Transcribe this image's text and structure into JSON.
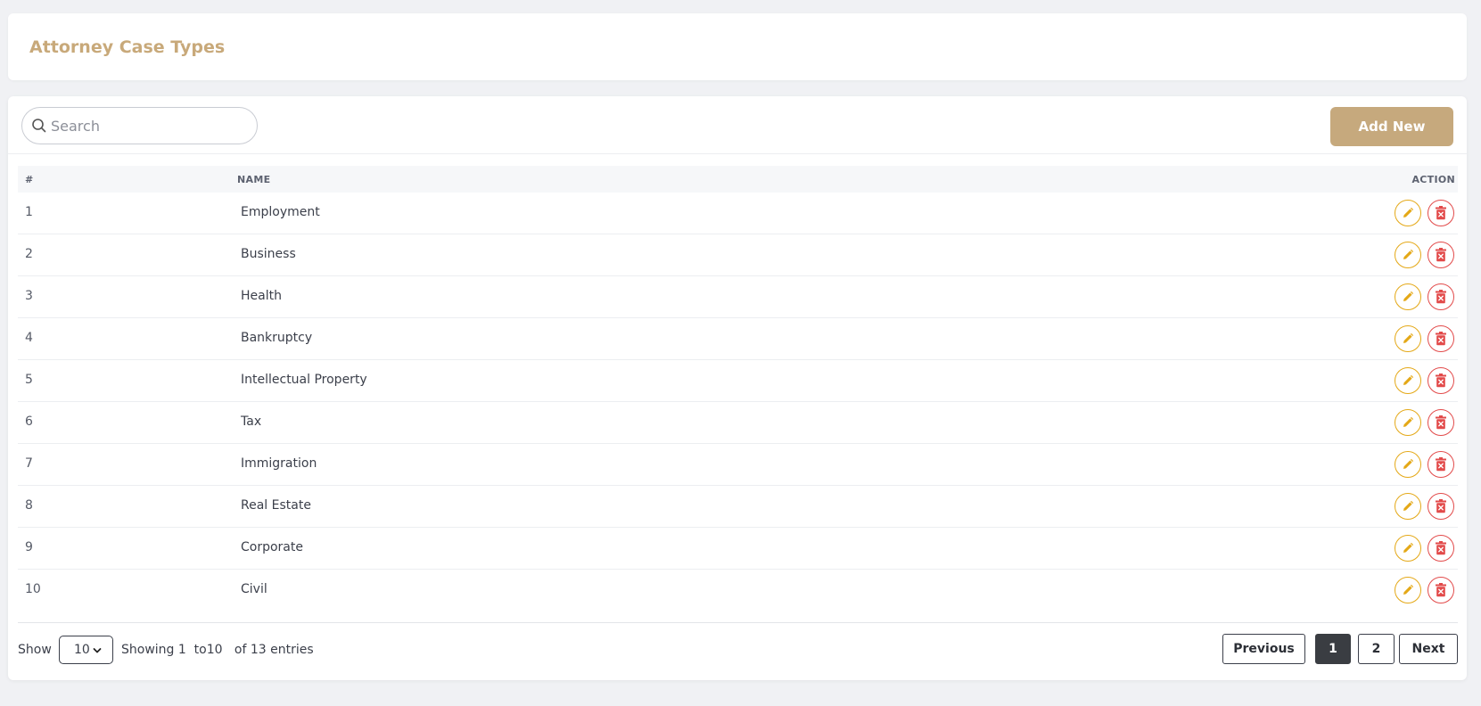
{
  "header": {
    "title": "Attorney Case Types"
  },
  "toolbar": {
    "search_placeholder": "Search",
    "search_value": "",
    "add_label": "Add New"
  },
  "table": {
    "columns": {
      "num": "#",
      "name": "NAME",
      "action": "ACTION"
    },
    "rows": [
      {
        "num": "1",
        "name": "Employment"
      },
      {
        "num": "2",
        "name": "Business"
      },
      {
        "num": "3",
        "name": "Health"
      },
      {
        "num": "4",
        "name": "Bankruptcy"
      },
      {
        "num": "5",
        "name": "Intellectual Property"
      },
      {
        "num": "6",
        "name": "Tax"
      },
      {
        "num": "7",
        "name": "Immigration"
      },
      {
        "num": "8",
        "name": "Real Estate"
      },
      {
        "num": "9",
        "name": "Corporate"
      },
      {
        "num": "10",
        "name": "Civil"
      }
    ],
    "row_icons": {
      "edit": "pencil-icon",
      "delete": "trash-icon"
    }
  },
  "footer": {
    "show_label": "Show",
    "page_size": "10",
    "entries_text": "Showing 1  to10   of 13 entries",
    "pagination": {
      "previous": "Previous",
      "pages": [
        "1",
        "2"
      ],
      "current": "1",
      "next": "Next"
    }
  },
  "colors": {
    "accent": "#c6a97d",
    "title": "#c8a97a",
    "edit": "#e4a816",
    "delete": "#e24a4a",
    "active_page": "#3a3d42"
  }
}
